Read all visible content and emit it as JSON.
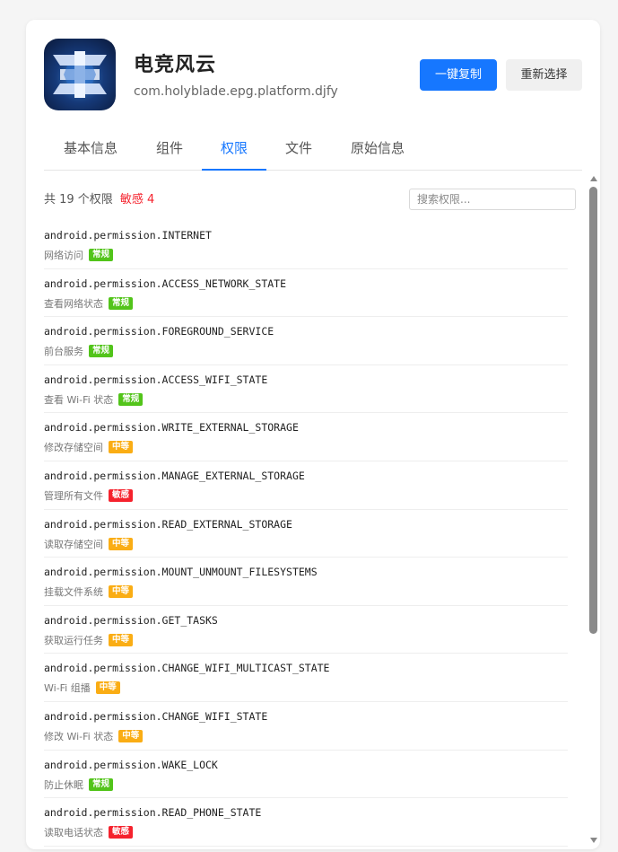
{
  "app": {
    "name": "电竞风云",
    "package": "com.holyblade.epg.platform.djfy"
  },
  "actions": {
    "copy_label": "一键复制",
    "reselect_label": "重新选择"
  },
  "tabs": [
    {
      "label": "基本信息",
      "active": false
    },
    {
      "label": "组件",
      "active": false
    },
    {
      "label": "权限",
      "active": true
    },
    {
      "label": "文件",
      "active": false
    },
    {
      "label": "原始信息",
      "active": false
    }
  ],
  "summary": {
    "total": "共 19 个权限",
    "sensitive": "敏感 4"
  },
  "search": {
    "placeholder": "搜索权限...",
    "value": ""
  },
  "badge_colors": {
    "常规": "#52c41a",
    "中等": "#faad14",
    "敏感": "#f5222d"
  },
  "permissions": [
    {
      "name": "android.permission.INTERNET",
      "desc": "网络访问",
      "level": "常规"
    },
    {
      "name": "android.permission.ACCESS_NETWORK_STATE",
      "desc": "查看网络状态",
      "level": "常规"
    },
    {
      "name": "android.permission.FOREGROUND_SERVICE",
      "desc": "前台服务",
      "level": "常规"
    },
    {
      "name": "android.permission.ACCESS_WIFI_STATE",
      "desc": "查看 Wi-Fi 状态",
      "level": "常规"
    },
    {
      "name": "android.permission.WRITE_EXTERNAL_STORAGE",
      "desc": "修改存储空间",
      "level": "中等"
    },
    {
      "name": "android.permission.MANAGE_EXTERNAL_STORAGE",
      "desc": "管理所有文件",
      "level": "敏感"
    },
    {
      "name": "android.permission.READ_EXTERNAL_STORAGE",
      "desc": "读取存储空间",
      "level": "中等"
    },
    {
      "name": "android.permission.MOUNT_UNMOUNT_FILESYSTEMS",
      "desc": "挂载文件系统",
      "level": "中等"
    },
    {
      "name": "android.permission.GET_TASKS",
      "desc": "获取运行任务",
      "level": "中等"
    },
    {
      "name": "android.permission.CHANGE_WIFI_MULTICAST_STATE",
      "desc": "Wi-Fi 组播",
      "level": "中等"
    },
    {
      "name": "android.permission.CHANGE_WIFI_STATE",
      "desc": "修改 Wi-Fi 状态",
      "level": "中等"
    },
    {
      "name": "android.permission.WAKE_LOCK",
      "desc": "防止休眠",
      "level": "常规"
    },
    {
      "name": "android.permission.READ_PHONE_STATE",
      "desc": "读取电话状态",
      "level": "敏感"
    }
  ]
}
